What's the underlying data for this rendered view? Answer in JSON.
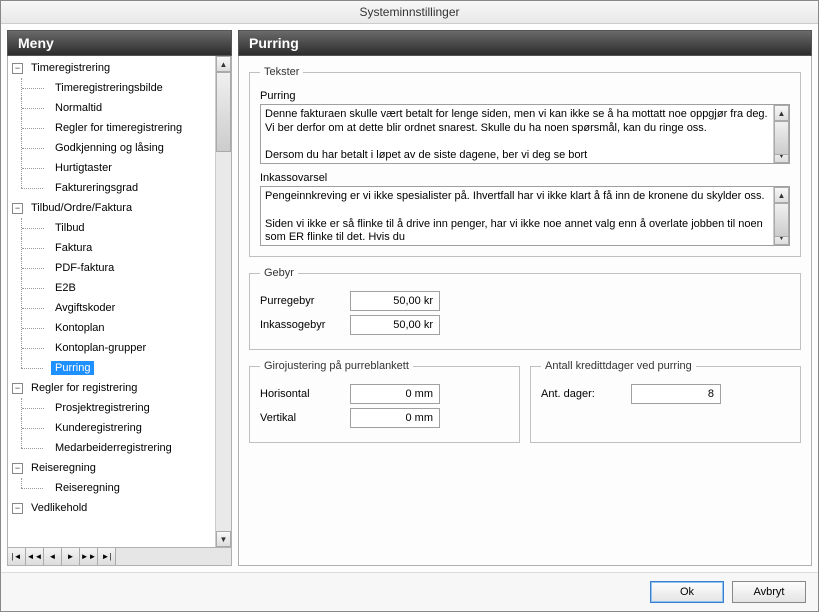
{
  "window": {
    "title": "Systeminnstillinger"
  },
  "panels": {
    "left_title": "Meny",
    "right_title": "Purring"
  },
  "tree": {
    "timeregistrering": {
      "label": "Timeregistrering",
      "children": [
        "Timeregistreringsbilde",
        "Normaltid",
        "Regler for timeregistrering",
        "Godkjenning og låsing",
        "Hurtigtaster",
        "Faktureringsgrad"
      ]
    },
    "tof": {
      "label": "Tilbud/Ordre/Faktura",
      "children": [
        "Tilbud",
        "Faktura",
        "PDF-faktura",
        "E2B",
        "Avgiftskoder",
        "Kontoplan",
        "Kontoplan-grupper",
        "Purring"
      ]
    },
    "regler": {
      "label": "Regler for registrering",
      "children": [
        "Prosjektregistrering",
        "Kunderegistrering",
        "Medarbeiderregistrering"
      ]
    },
    "reise": {
      "label": "Reiseregning",
      "children": [
        "Reiseregning"
      ]
    },
    "vedlikehold": {
      "label": "Vedlikehold"
    },
    "selected_path": "tof.7"
  },
  "tekster": {
    "legend": "Tekster",
    "purring_label": "Purring",
    "purring_text": "Denne fakturaen skulle vært betalt for lenge siden, men vi kan ikke se å ha mottatt noe oppgjør fra deg. Vi ber derfor om at dette blir ordnet snarest. Skulle du ha noen spørsmål, kan du ringe oss.\n\nDersom du har betalt i løpet av de siste dagene, ber vi deg se bort",
    "inkasso_label": "Inkassovarsel",
    "inkasso_text": "Pengeinnkreving er vi ikke spesialister på. Ihvertfall har vi ikke klart å få inn de kronene du skylder oss.\n\nSiden vi ikke er så flinke til å drive inn penger, har vi ikke noe annet valg enn å overlate jobben til noen som ER flinke til det. Hvis du"
  },
  "gebyr": {
    "legend": "Gebyr",
    "purregebyr_label": "Purregebyr",
    "purregebyr_value": "50,00 kr",
    "inkassogebyr_label": "Inkassogebyr",
    "inkassogebyr_value": "50,00 kr"
  },
  "giro": {
    "legend": "Girojustering på purreblankett",
    "horisontal_label": "Horisontal",
    "horisontal_value": "0 mm",
    "vertikal_label": "Vertikal",
    "vertikal_value": "0 mm"
  },
  "kredittdager": {
    "legend": "Antall kredittdager ved purring",
    "label": "Ant. dager:",
    "value": "8"
  },
  "buttons": {
    "ok": "Ok",
    "cancel": "Avbryt"
  }
}
